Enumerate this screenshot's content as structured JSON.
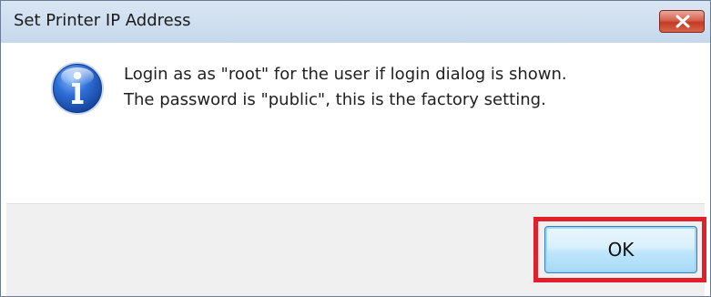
{
  "window": {
    "title": "Set Printer IP Address",
    "close_icon": "close-icon"
  },
  "message": {
    "icon": "info-icon",
    "line1": "Login as as \"root\" for the user if login dialog is shown.",
    "line2": "The password is \"public\", this is the factory setting."
  },
  "buttons": {
    "ok_label": "OK"
  },
  "colors": {
    "highlight": "#e0202b",
    "close_button": "#c43b25",
    "info_icon": "#1f56b8"
  }
}
